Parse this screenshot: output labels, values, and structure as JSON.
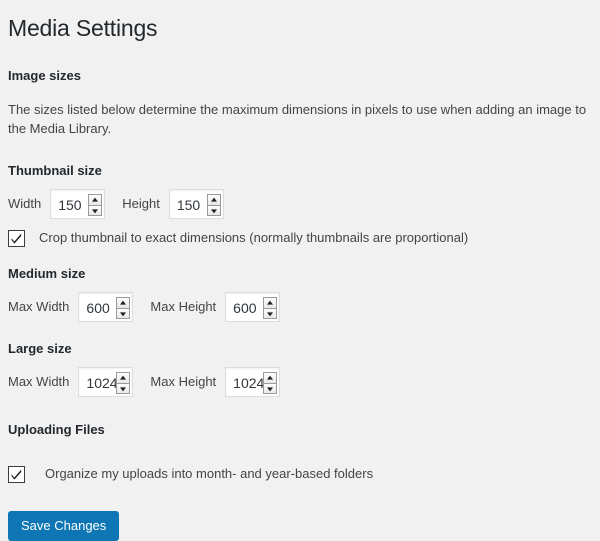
{
  "page": {
    "title": "Media Settings"
  },
  "image_sizes": {
    "heading": "Image sizes",
    "description": "The sizes listed below determine the maximum dimensions in pixels to use when adding an image to the Media Library.",
    "thumbnail": {
      "heading": "Thumbnail size",
      "width_label": "Width",
      "width_value": "150",
      "height_label": "Height",
      "height_value": "150",
      "crop_label": "Crop thumbnail to exact dimensions (normally thumbnails are proportional)",
      "crop_checked": "checked"
    },
    "medium": {
      "heading": "Medium size",
      "width_label": "Max Width",
      "width_value": "600",
      "height_label": "Max Height",
      "height_value": "600"
    },
    "large": {
      "heading": "Large size",
      "width_label": "Max Width",
      "width_value": "1024",
      "height_label": "Max Height",
      "height_value": "1024"
    }
  },
  "uploading_files": {
    "heading": "Uploading Files",
    "organize_label": "Organize my uploads into month- and year-based folders",
    "organize_checked": "checked"
  },
  "submit": {
    "save_label": "Save Changes"
  },
  "colors": {
    "background": "#f1f1f1",
    "heading_text": "#23282d",
    "body_text": "#444444",
    "button_blue": "#0e76b5",
    "input_border": "#dddddd"
  }
}
